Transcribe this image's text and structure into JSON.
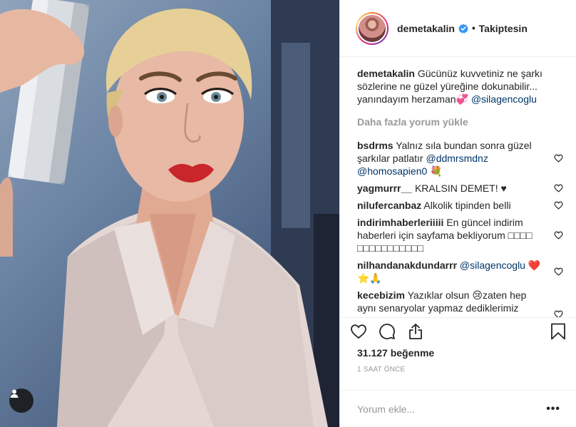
{
  "post": {
    "username": "demetakalin",
    "verified": true,
    "separator": "•",
    "follow_status": "Takiptesin",
    "caption": {
      "username": "demetakalin",
      "text": "Gücünüz kuvvetiniz ne şarkı sözlerine ne güzel yüreğine dokunabilir... yanındayım herzaman💞 ",
      "mention": "@silagencoglu"
    },
    "load_more": "Daha fazla yorum yükle",
    "comments": [
      {
        "username": "bsdrms",
        "text": "Yalnız sıla bundan sonra güzel şarkılar patlatır ",
        "mention": "@ddmrsmdnz @homosapien0",
        "suffix": " 💐"
      },
      {
        "username": "yagmurrr__",
        "text": "KRALSIN DEMET! ♥",
        "mention": "",
        "suffix": ""
      },
      {
        "username": "nilufercanbaz",
        "text": "Alkolik tipinden belli",
        "mention": "",
        "suffix": ""
      },
      {
        "username": "indirimhaberleriiiii",
        "text": "En güncel indirim haberleri için sayfama bekliyorum □□□□ □□□□□□□□□□□",
        "mention": "",
        "suffix": ""
      },
      {
        "username": "nilhandanakdundarrr",
        "text": "",
        "mention": "@silagencoglu",
        "suffix": " ❤️⭐🙏"
      },
      {
        "username": "kecebizim",
        "text": "Yazıklar olsun 😢zaten hep aynı senaryolar yapmaz dediklerimiz yapıyo bu hayatta dış görünüşü iyi gördüklerimiz içimizi acıtıyor kadın",
        "mention": "",
        "suffix": ""
      }
    ],
    "likes": "31.127 beğenme",
    "time": "1 SAAT ÖNCE",
    "comment_placeholder": "Yorum ekle...",
    "more": "•••"
  },
  "icons": {
    "verified": "verified-badge-icon",
    "heart": "heart-icon",
    "comment": "comment-icon",
    "share": "share-icon",
    "save": "bookmark-icon",
    "user_tag": "user-tag-icon"
  },
  "colors": {
    "verified": "#3897f0",
    "mention": "#003569",
    "muted": "#999999",
    "text": "#262626",
    "lipstick": "#c8262a"
  }
}
